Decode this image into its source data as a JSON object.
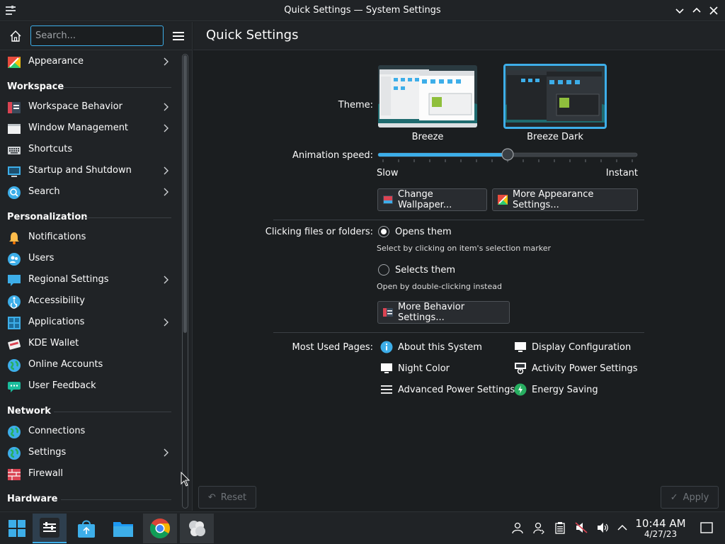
{
  "window": {
    "title": "Quick Settings — System Settings"
  },
  "search": {
    "placeholder": "Search..."
  },
  "sidebar": {
    "appearance": "Appearance",
    "categories": {
      "workspace": "Workspace",
      "personalization": "Personalization",
      "network": "Network",
      "hardware": "Hardware"
    },
    "items": [
      {
        "label": "Workspace Behavior"
      },
      {
        "label": "Window Management"
      },
      {
        "label": "Shortcuts"
      },
      {
        "label": "Startup and Shutdown"
      },
      {
        "label": "Search"
      },
      {
        "label": "Notifications"
      },
      {
        "label": "Users"
      },
      {
        "label": "Regional Settings"
      },
      {
        "label": "Accessibility"
      },
      {
        "label": "Applications"
      },
      {
        "label": "KDE Wallet"
      },
      {
        "label": "Online Accounts"
      },
      {
        "label": "User Feedback"
      },
      {
        "label": "Connections"
      },
      {
        "label": "Settings"
      },
      {
        "label": "Firewall"
      }
    ]
  },
  "main": {
    "title": "Quick Settings",
    "theme_label": "Theme:",
    "themes": [
      {
        "name": "Breeze",
        "selected": false
      },
      {
        "name": "Breeze Dark",
        "selected": true
      }
    ],
    "animation_label": "Animation speed:",
    "animation_slow": "Slow",
    "animation_instant": "Instant",
    "animation_level": 0.5,
    "change_wallpaper": "Change Wallpaper...",
    "more_appearance": "More Appearance Settings...",
    "clicking_label": "Clicking files or folders:",
    "opens_them": "Opens them",
    "opens_hint": "Select by clicking on item's selection marker",
    "selects_them": "Selects them",
    "selects_hint": "Open by double-clicking instead",
    "more_behavior": "More Behavior Settings...",
    "most_used_label": "Most Used Pages:",
    "most_used": [
      {
        "label": "About this System",
        "icon": "info-icon"
      },
      {
        "label": "Display Configuration",
        "icon": "monitor-icon"
      },
      {
        "label": "Night Color",
        "icon": "monitor-icon"
      },
      {
        "label": "Activity Power Settings",
        "icon": "power-settings-icon"
      },
      {
        "label": "Advanced Power Settings",
        "icon": "menu-lines-icon"
      },
      {
        "label": "Energy Saving",
        "icon": "energy-icon"
      }
    ],
    "reset": "Reset",
    "apply": "Apply"
  },
  "taskbar": {
    "time": "10:44 AM",
    "date": "4/27/23"
  },
  "colors": {
    "accent": "#3daee9",
    "bg": "#1b1e20",
    "panel": "#202326"
  }
}
